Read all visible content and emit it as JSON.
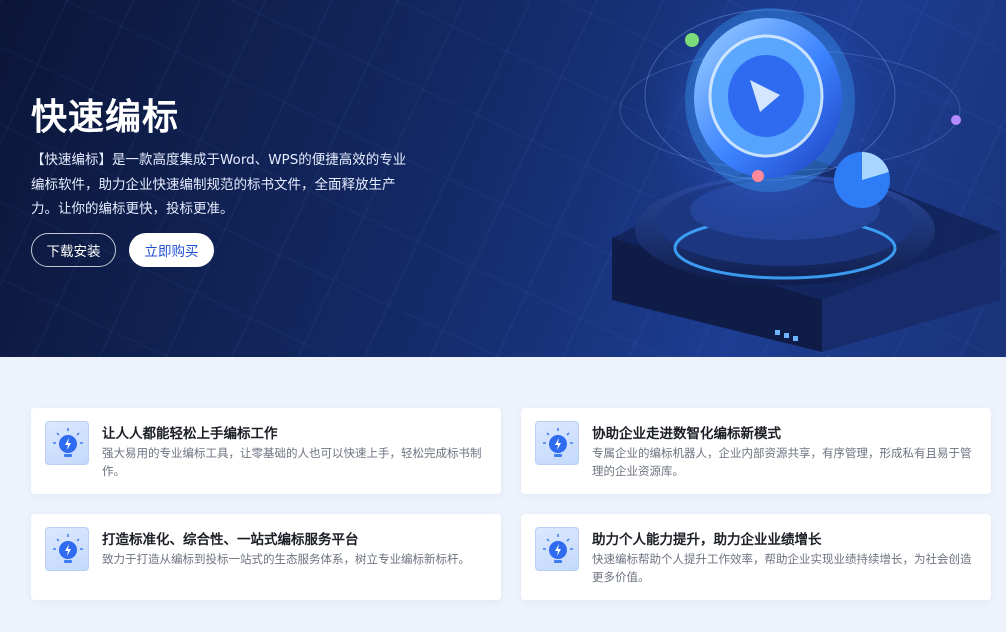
{
  "hero": {
    "title": "快速编标",
    "description": "【快速编标】是一款高度集成于Word、WPS的便捷高效的专业编标软件，助力企业快速编制规范的标书文件，全面释放生产力。让你的编标更快，投标更准。",
    "download_label": "下载安装",
    "buy_label": "立即购买"
  },
  "features": [
    {
      "title": "让人人都能轻松上手编标工作",
      "desc": "强大易用的专业编标工具，让零基础的人也可以快速上手，轻松完成标书制作。",
      "icon": "lightbulb-icon"
    },
    {
      "title": "协助企业走进数智化编标新模式",
      "desc": "专属企业的编标机器人，企业内部资源共享，有序管理，形成私有且易于管理的企业资源库。",
      "icon": "lightbulb-icon"
    },
    {
      "title": "打造标准化、综合性、一站式编标服务平台",
      "desc": "致力于打造从编标到投标一站式的生态服务体系，树立专业编标新标杆。",
      "icon": "lightbulb-icon"
    },
    {
      "title": "助力个人能力提升，助力企业业绩增长",
      "desc": "快速编标帮助个人提升工作效率，帮助企业实现业绩持续增长，为社会创造更多价值。",
      "icon": "lightbulb-icon"
    }
  ],
  "colors": {
    "hero_dark": "#0b1638",
    "hero_blue": "#1d3d92",
    "accent": "#1f4fd6"
  }
}
